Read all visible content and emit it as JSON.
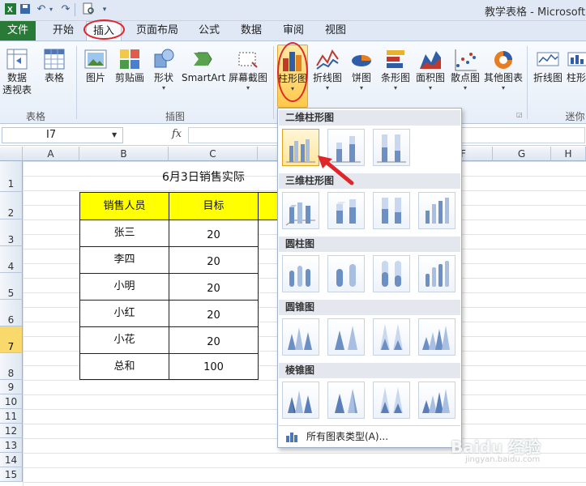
{
  "titlebar": {
    "doc_title": "教学表格 - Microsoft"
  },
  "tabs": [
    {
      "label": "文件"
    },
    {
      "label": "开始"
    },
    {
      "label": "插入"
    },
    {
      "label": "页面布局"
    },
    {
      "label": "公式"
    },
    {
      "label": "数据"
    },
    {
      "label": "审阅"
    },
    {
      "label": "视图"
    }
  ],
  "ribbon": {
    "buttons": [
      {
        "label": "数据",
        "label2": "透视表"
      },
      {
        "label": "表格"
      },
      {
        "label": "图片"
      },
      {
        "label": "剪贴画"
      },
      {
        "label": "形状"
      },
      {
        "label": "SmartArt"
      },
      {
        "label": "屏幕截图"
      },
      {
        "label": "柱形图"
      },
      {
        "label": "折线图"
      },
      {
        "label": "饼图"
      },
      {
        "label": "条形图"
      },
      {
        "label": "面积图"
      },
      {
        "label": "散点图"
      },
      {
        "label": "其他图表"
      },
      {
        "label": "折线图"
      },
      {
        "label": "柱形"
      }
    ],
    "groups": {
      "table": "表格",
      "illustrations": "插图",
      "sparklines": "迷你"
    }
  },
  "formula_bar": {
    "name_box": "I7",
    "fx": "fx",
    "value": ""
  },
  "columns": [
    "A",
    "B",
    "C",
    "F",
    "G",
    "H"
  ],
  "rows": [
    "1",
    "2",
    "3",
    "4",
    "5",
    "6",
    "7",
    "8",
    "9",
    "10",
    "11",
    "12",
    "13",
    "14",
    "15"
  ],
  "sheet": {
    "title": "6月3日销售实际",
    "headers": [
      "销售人员",
      "目标"
    ],
    "rows": [
      [
        "张三",
        "20"
      ],
      [
        "李四",
        "20"
      ],
      [
        "小明",
        "20"
      ],
      [
        "小红",
        "20"
      ],
      [
        "小花",
        "20"
      ],
      [
        "总和",
        "100"
      ]
    ]
  },
  "dropdown": {
    "sections": [
      "二维柱形图",
      "三维柱形图",
      "圆柱图",
      "圆锥图",
      "棱锥图"
    ],
    "all_types": "所有图表类型(A)..."
  },
  "colors": {
    "file_tab": "#2a7a37",
    "header_fill": "#ffff00",
    "annotation": "#e0252b"
  },
  "watermark": {
    "text": "Baidu 经验",
    "sub": "jingyan.baidu.com"
  }
}
